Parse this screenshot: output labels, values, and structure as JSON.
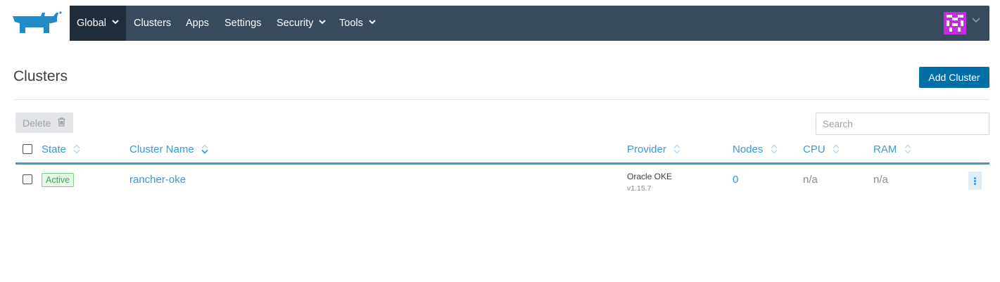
{
  "nav": {
    "items": [
      {
        "label": "Global",
        "has_dropdown": true,
        "active": true
      },
      {
        "label": "Clusters",
        "has_dropdown": false
      },
      {
        "label": "Apps",
        "has_dropdown": false
      },
      {
        "label": "Settings",
        "has_dropdown": false
      },
      {
        "label": "Security",
        "has_dropdown": true
      },
      {
        "label": "Tools",
        "has_dropdown": true
      }
    ],
    "logo_icon": "rancher-cow-logo",
    "avatar_icon": "identicon-avatar"
  },
  "page": {
    "title": "Clusters",
    "add_button": "Add Cluster"
  },
  "toolbar": {
    "delete_label": "Delete",
    "search_placeholder": "Search"
  },
  "table": {
    "columns": [
      "State",
      "Cluster Name",
      "Provider",
      "Nodes",
      "CPU",
      "RAM"
    ],
    "rows": [
      {
        "state": "Active",
        "name": "rancher-oke",
        "provider": "Oracle OKE",
        "version": "v1.15.7",
        "nodes": "0",
        "cpu": "n/a",
        "ram": "n/a"
      }
    ]
  },
  "colors": {
    "nav_bg": "#374a5e",
    "nav_active": "#1f2d3a",
    "accent": "#3d98d3",
    "primary_button": "#006fa8",
    "logo": "#1f8bc7",
    "avatar": "#c12fe0",
    "active_badge": "#3ea758"
  }
}
